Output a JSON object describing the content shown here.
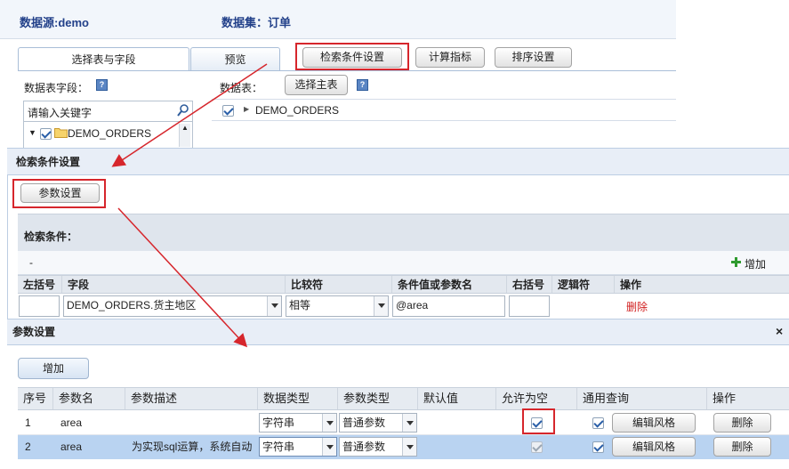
{
  "header": {
    "datasource_label": "数据源:demo",
    "dataset_label": "数据集：订单"
  },
  "tabs": {
    "select_fields": "选择表与字段",
    "preview": "预览"
  },
  "toolbar": {
    "search_condition": "检索条件设置",
    "calc_metric": "计算指标",
    "sort_setting": "排序设置"
  },
  "left_panel": {
    "fields_label": "数据表字段：",
    "search_placeholder": "请输入关键字",
    "tree_node": "DEMO_ORDERS"
  },
  "right_panel": {
    "table_label": "数据表：",
    "select_main_table": "选择主表",
    "table_item": "DEMO_ORDERS"
  },
  "search_dialog": {
    "title": "检索条件设置",
    "param_button": "参数设置",
    "conditions_label": "检索条件：",
    "dash": "-",
    "add_label": "增加",
    "columns": [
      "左括号",
      "字段",
      "比较符",
      "条件值或参数名",
      "右括号",
      "逻辑符",
      "操作"
    ],
    "row": {
      "field": "DEMO_ORDERS.货主地区",
      "operator": "相等",
      "value": "@area",
      "delete": "删除"
    }
  },
  "param_dialog": {
    "title": "参数设置",
    "close": "×",
    "add_button": "增加",
    "columns": [
      "序号",
      "参数名",
      "参数描述",
      "数据类型",
      "参数类型",
      "默认值",
      "允许为空",
      "通用查询",
      "操作"
    ],
    "rows": [
      {
        "index": "1",
        "name": "area",
        "desc": "",
        "data_type": "字符串",
        "param_type": "普通参数",
        "default": "",
        "allow_null": true,
        "common_query": true,
        "edit_style": "编辑风格",
        "delete": "删除"
      },
      {
        "index": "2",
        "name": "area",
        "desc": "为实现sql运算，系统自动",
        "data_type": "字符串",
        "param_type": "普通参数",
        "default": "",
        "allow_null": true,
        "common_query": true,
        "edit_style": "编辑风格",
        "delete": "删除"
      }
    ]
  },
  "colors": {
    "highlight": "#d6262c",
    "header_text": "#23418a",
    "selected_row": "#b9d3f1"
  }
}
